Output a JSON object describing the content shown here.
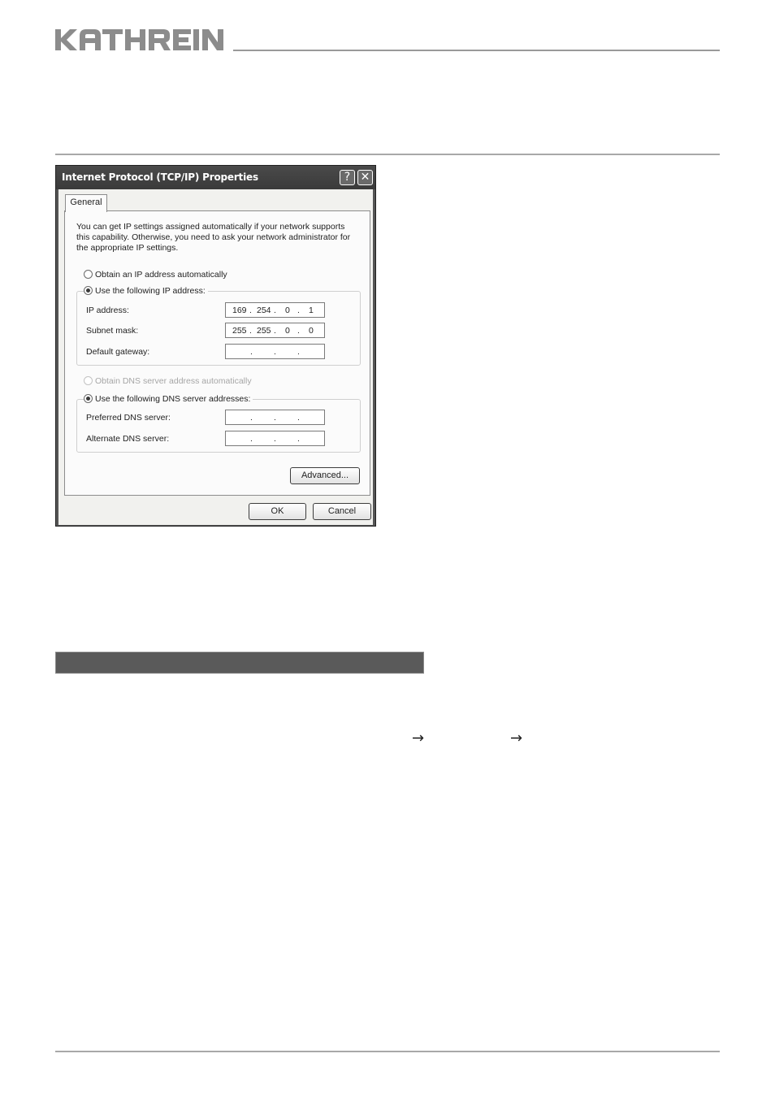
{
  "brand": {
    "logo_text": "KATHREIN"
  },
  "dialog": {
    "title": "Internet Protocol (TCP/IP) Properties",
    "help_button": "?",
    "close_button": "✕",
    "tab_general": "General",
    "description": "You can get IP settings assigned automatically if your network supports this capability. Otherwise, you need to ask your network administrator for the appropriate IP settings.",
    "radio_obtain_ip": {
      "label": "Obtain an IP address automatically",
      "checked": false
    },
    "radio_use_ip": {
      "label": "Use the following IP address:",
      "checked": true
    },
    "ip_address": {
      "label": "IP address:",
      "octets": [
        "169",
        "254",
        "0",
        "1"
      ]
    },
    "subnet_mask": {
      "label": "Subnet mask:",
      "octets": [
        "255",
        "255",
        "0",
        "0"
      ]
    },
    "default_gateway": {
      "label": "Default gateway:",
      "octets": [
        "",
        "",
        "",
        ""
      ]
    },
    "radio_obtain_dns": {
      "label": "Obtain DNS server address automatically",
      "checked": false,
      "disabled": true
    },
    "radio_use_dns": {
      "label": "Use the following DNS server addresses:",
      "checked": true
    },
    "preferred_dns": {
      "label": "Preferred DNS server:",
      "octets": [
        "",
        "",
        "",
        ""
      ]
    },
    "alternate_dns": {
      "label": "Alternate DNS server:",
      "octets": [
        "",
        "",
        "",
        ""
      ]
    },
    "advanced_button": "Advanced...",
    "ok_button": "OK",
    "cancel_button": "Cancel",
    "dot": "."
  },
  "arrows": {
    "symbol": "→"
  },
  "colors": {
    "title_bar": "#3f3f3f",
    "section_bar": "#5a5a5a",
    "rule": "#a8a8a8"
  }
}
